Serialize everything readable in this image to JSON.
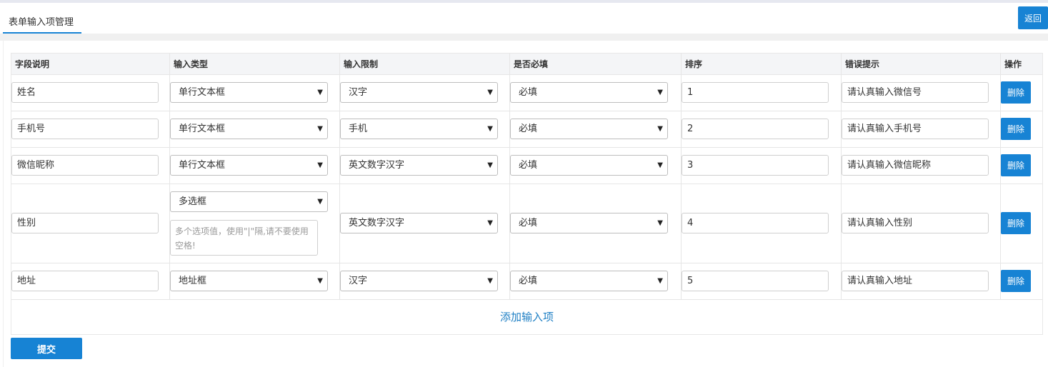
{
  "header": {
    "tab_label": "表单输入项管理",
    "back_label": "返回"
  },
  "table": {
    "columns": [
      "字段说明",
      "输入类型",
      "输入限制",
      "是否必填",
      "排序",
      "错误提示",
      "操作"
    ],
    "rows": [
      {
        "field": "姓名",
        "type": "单行文本框",
        "limit": "汉字",
        "required": "必填",
        "order": "1",
        "error": "请认真输入微信号",
        "action": "删除"
      },
      {
        "field": "手机号",
        "type": "单行文本框",
        "limit": "手机",
        "required": "必填",
        "order": "2",
        "error": "请认真输入手机号",
        "action": "删除"
      },
      {
        "field": "微信昵称",
        "type": "单行文本框",
        "limit": "英文数字汉字",
        "required": "必填",
        "order": "3",
        "error": "请认真输入微信昵称",
        "action": "删除"
      },
      {
        "field": "性别",
        "type": "多选框",
        "options_placeholder": "多个选项值，使用\"|\"隔,请不要使用空格!",
        "limit": "英文数字汉字",
        "required": "必填",
        "order": "4",
        "error": "请认真输入性别",
        "action": "删除"
      },
      {
        "field": "地址",
        "type": "地址框",
        "limit": "汉字",
        "required": "必填",
        "order": "5",
        "error": "请认真输入地址",
        "action": "删除"
      }
    ],
    "add_label": "添加输入项"
  },
  "submit_label": "提交",
  "icons": {
    "select_arrow": "▼"
  },
  "colors": {
    "primary": "#1783d4",
    "link": "#1e7fc4"
  }
}
